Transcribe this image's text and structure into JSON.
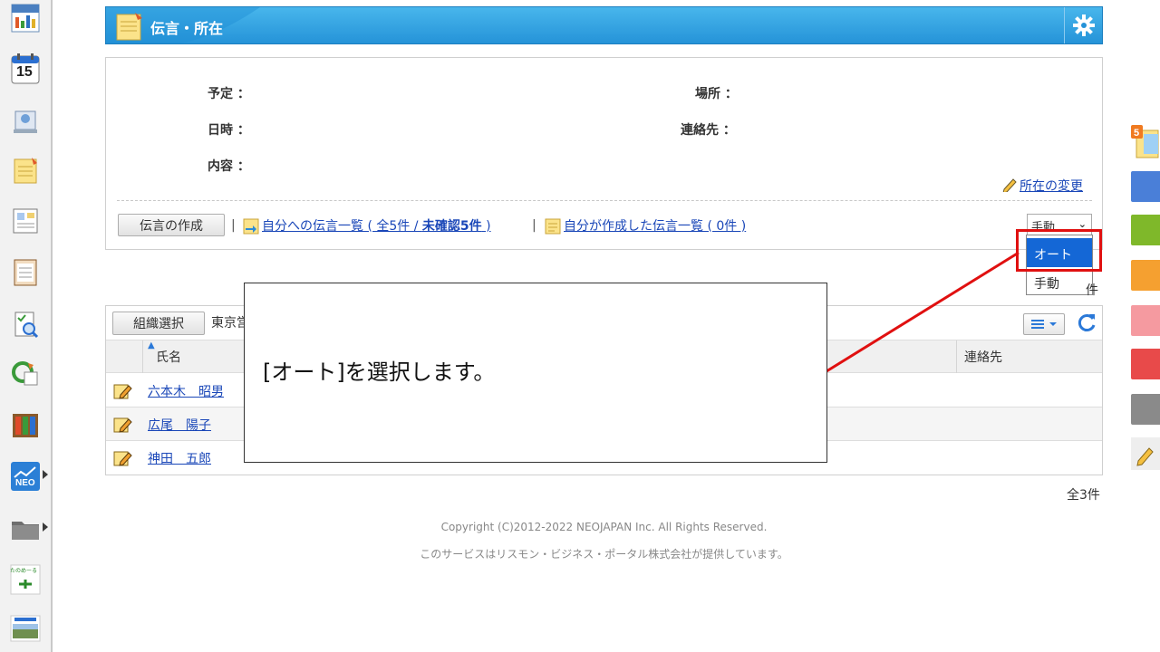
{
  "sidebar": {
    "apps": [
      {
        "icon": "portal-icon"
      },
      {
        "icon": "calendar-icon",
        "day": "15"
      },
      {
        "icon": "facility-icon"
      },
      {
        "icon": "message-memo-icon"
      },
      {
        "icon": "bulletin-icon"
      },
      {
        "icon": "clipboard-icon"
      },
      {
        "icon": "search-document-icon"
      },
      {
        "icon": "workflow-icon"
      },
      {
        "icon": "cabinet-icon"
      },
      {
        "icon": "neo-icon",
        "label": "NEO"
      },
      {
        "icon": "folder-icon"
      },
      {
        "icon": "tanomiru-icon",
        "label": "たのめーる"
      },
      {
        "icon": "banner-icon"
      }
    ]
  },
  "header": {
    "title": "伝言・所在"
  },
  "info": {
    "schedule_label": "予定 ：",
    "datetime_label": "日時 ：",
    "content_label": "内容 ：",
    "place_label": "場所 ：",
    "contact_label": "連絡先 ：",
    "change_location_link": "所在の変更",
    "create_message_button": "伝言の作成",
    "separator": "|",
    "to_me_link_prefix": "自分への伝言一覧 ( 全5件 / ",
    "to_me_link_unconfirmed": "未確認5件",
    "to_me_link_suffix": " )",
    "created_by_me_link": "自分が作成した伝言一覧 ( 0件 )",
    "mode_select_value": "手動"
  },
  "dropdown": {
    "options": [
      {
        "label": "オート",
        "selected": true
      },
      {
        "label": "手動",
        "selected": false
      }
    ]
  },
  "count_top": "件",
  "directory": {
    "org_button": "組織選択",
    "org_name": "東京営",
    "columns": {
      "name": "氏名",
      "contact": "連絡先"
    },
    "rows": [
      {
        "name": "六本木　昭男"
      },
      {
        "name": "広尾　陽子"
      },
      {
        "name": "神田　五郎"
      }
    ],
    "total": "全3件"
  },
  "footer": {
    "copyright": "Copyright (C)2012-2022 NEOJAPAN Inc. All Rights Reserved.",
    "provider": "このサービスはリスモン・ビジネス・ポータル株式会社が提供しています。"
  },
  "callout": {
    "text": "[オート]を選択します。"
  },
  "colors": {
    "accent": "#2593d8",
    "highlight": "#e01010",
    "selected": "#1467d6"
  }
}
